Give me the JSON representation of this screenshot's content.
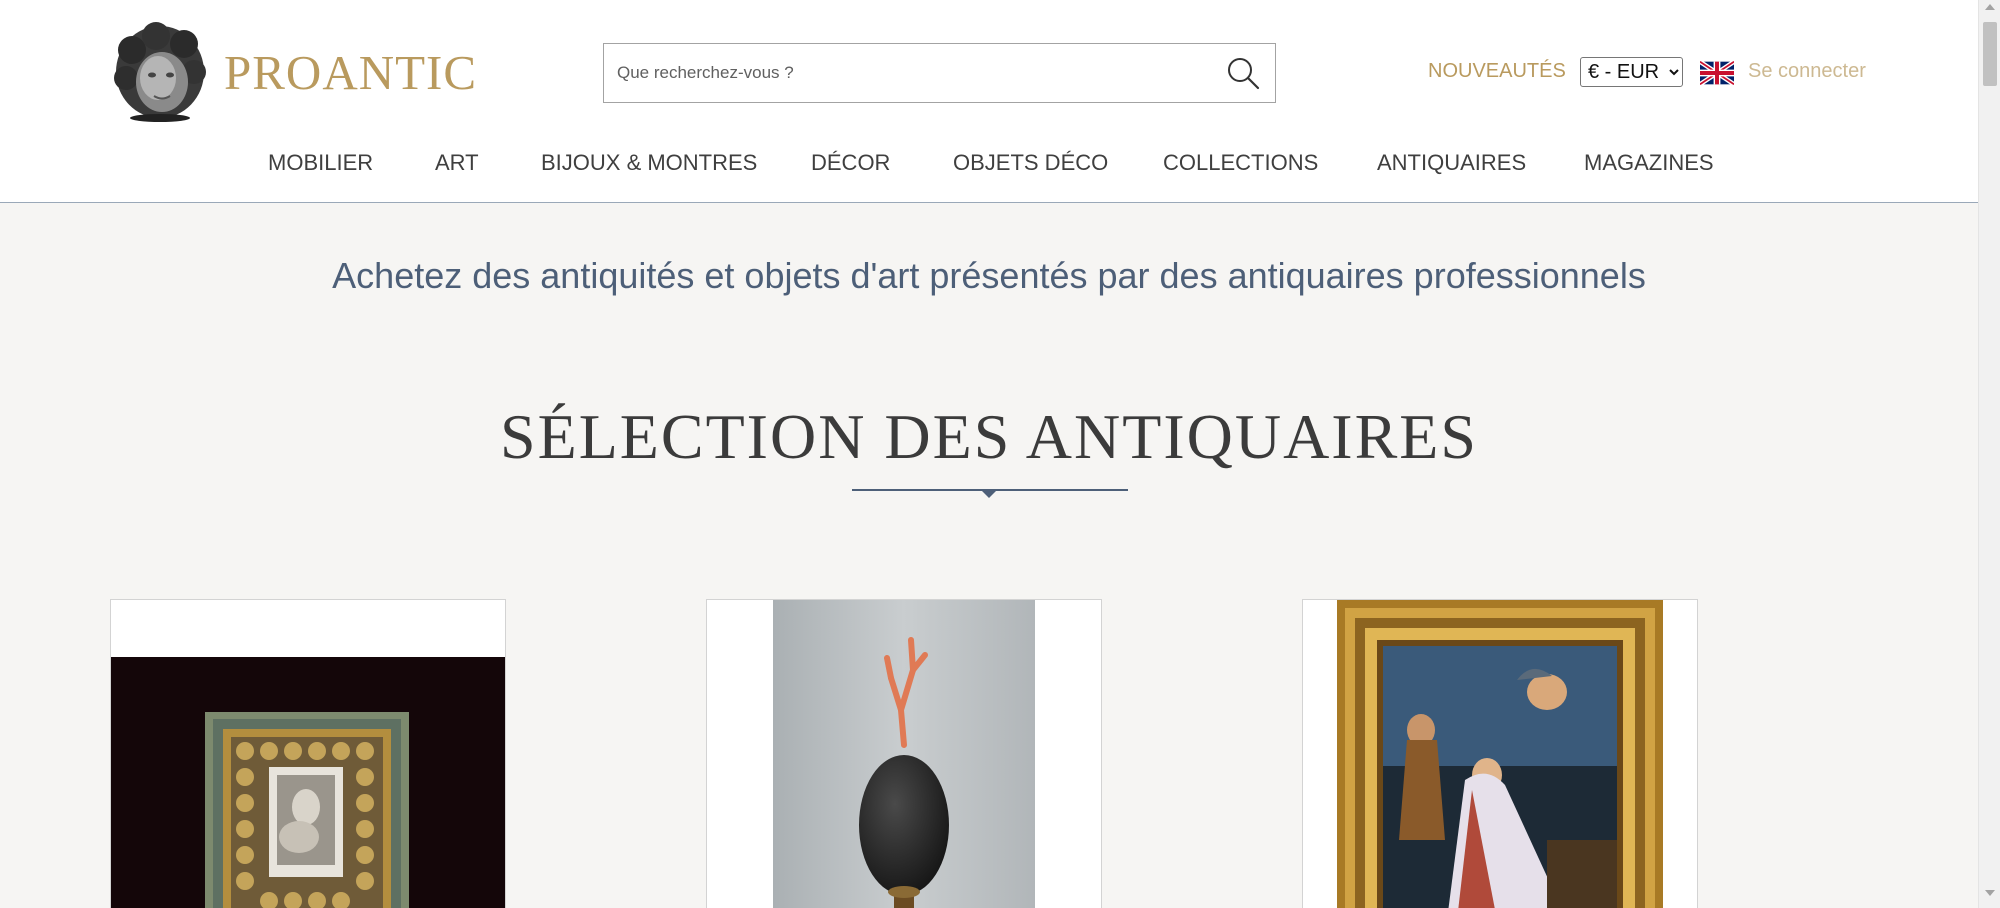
{
  "brand": {
    "name": "PROANTIC",
    "logo_icon": "cherub-head-logo-icon",
    "color": "#b99a5e"
  },
  "search": {
    "placeholder": "Que recherchez-vous ?",
    "icon": "search-icon"
  },
  "header_links": {
    "new_label": "NOUVEAUTÉS",
    "currency_selected": "€ - EUR",
    "language_icon": "uk-flag-icon",
    "login_label": "Se connecter"
  },
  "nav": {
    "items": [
      {
        "label": "MOBILIER"
      },
      {
        "label": "ART"
      },
      {
        "label": "BIJOUX & MONTRES"
      },
      {
        "label": "DÉCOR"
      },
      {
        "label": "OBJETS DÉCO"
      },
      {
        "label": "COLLECTIONS"
      },
      {
        "label": "ANTIQUAIRES"
      },
      {
        "label": "MAGAZINES"
      }
    ]
  },
  "main": {
    "tagline": "Achetez des antiquités et objets d'art présentés par des antiquaires professionnels",
    "section_title": "SÉLECTION DES ANTIQUAIRES"
  },
  "products": [
    {
      "image": "framed-devotional-image-photo"
    },
    {
      "image": "ostrich-egg-with-coral-photo"
    },
    {
      "image": "gilt-framed-painting-photo"
    }
  ],
  "colors": {
    "accent_gold": "#b99a5e",
    "nav_text": "#3f3f3f",
    "tagline_blue": "#4d5f78",
    "background": "#f6f5f3"
  }
}
